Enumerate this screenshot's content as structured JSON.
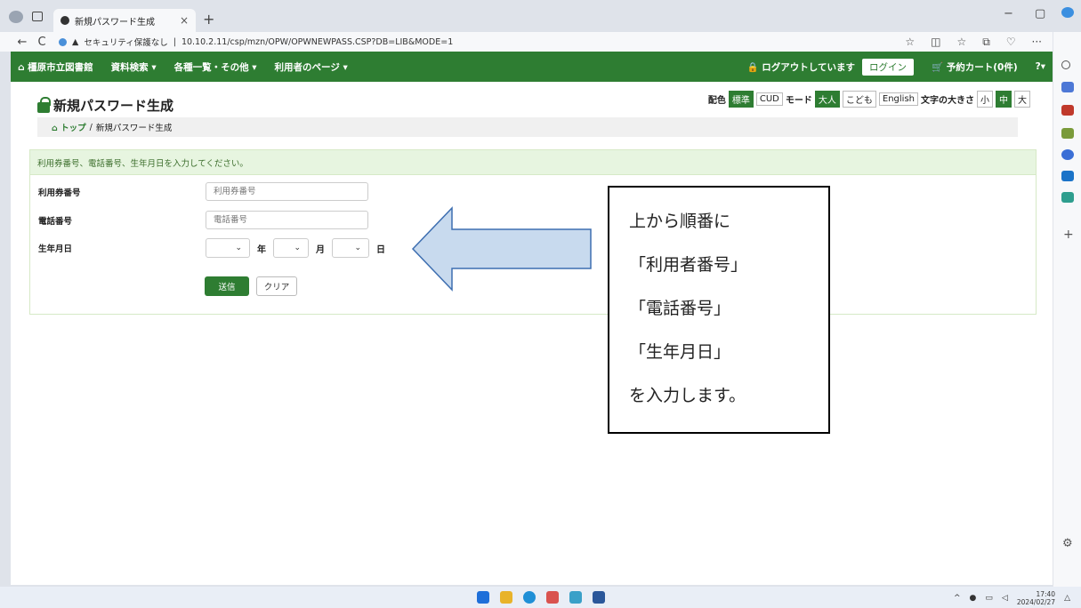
{
  "browser": {
    "tab_title": "新規パスワード生成",
    "tab_close": "×",
    "new_tab": "+",
    "security_label": "セキュリティ保護なし",
    "url": "10.10.2.11/csp/mzn/OPW/OPWNEWPASS.CSP?DB=LIB&MODE=1",
    "back": "←",
    "reload": "C",
    "more": "···",
    "minimize": "−",
    "maximize": "▢",
    "close": "×",
    "add": "+"
  },
  "sitenav": {
    "home": "橿原市立図書館",
    "search": "資料検索 ▾",
    "lists": "各種一覧・その他 ▾",
    "mypage": "利用者のページ ▾",
    "logout_status": "ログアウトしています",
    "login": "ログイン",
    "cart": "予約カート(0件)",
    "help": "?▾"
  },
  "page": {
    "title": "新規パスワード生成",
    "prefs": {
      "color_label": "配色",
      "color_standard": "標準",
      "color_cud": "CUD",
      "mode_label": "モード",
      "mode_adult": "大人",
      "mode_child": "こども",
      "mode_english": "English",
      "size_label": "文字の大きさ",
      "size_small": "小",
      "size_medium": "中",
      "size_large": "大"
    },
    "breadcrumb": {
      "top": "トップ",
      "sep": "/",
      "current": "新規パスワード生成"
    },
    "form": {
      "instruction": "利用券番号、電話番号、生年月日を入力してください。",
      "card_label": "利用券番号",
      "card_placeholder": "利用券番号",
      "phone_label": "電話番号",
      "phone_placeholder": "電話番号",
      "birth_label": "生年月日",
      "year_unit": "年",
      "month_unit": "月",
      "day_unit": "日",
      "submit": "送信",
      "clear": "クリア"
    }
  },
  "annotation": {
    "lines": [
      "上から順番に",
      "「利用者番号」",
      "「電話番号」",
      "「生年月日」",
      "を入力します。"
    ]
  },
  "taskbar": {
    "time": "17:40",
    "date": "2024/02/27"
  },
  "colors": {
    "brand_green": "#2e7d32",
    "notice_bg": "#e7f5e0",
    "arrow_fill": "#c8daee",
    "arrow_stroke": "#3d6eb0"
  }
}
